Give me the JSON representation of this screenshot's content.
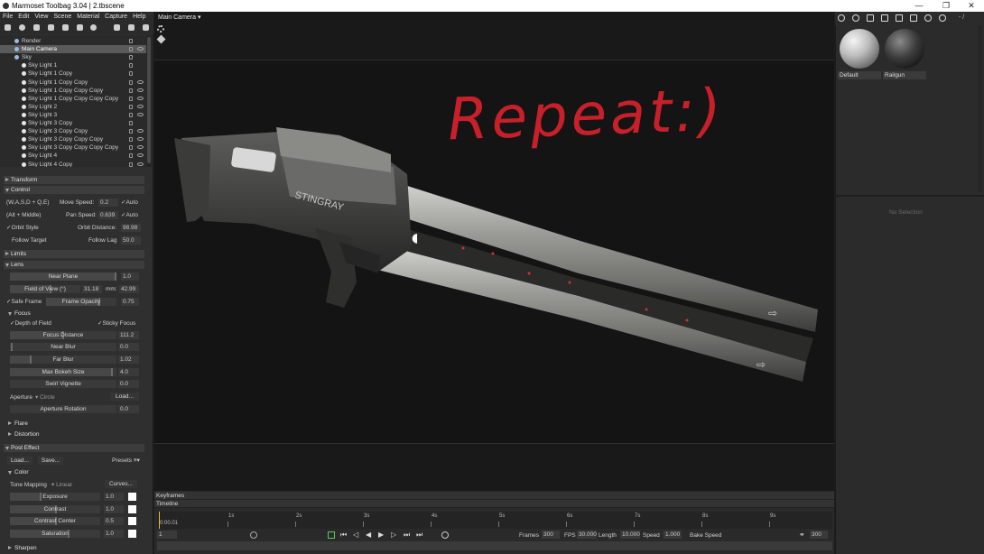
{
  "titlebar": {
    "title": "Marmoset Toolbag 3.04  |  2.tbscene",
    "minimize": "—",
    "maximize": "❐",
    "close": "✕"
  },
  "menu": [
    "File",
    "Edit",
    "View",
    "Scene",
    "Material",
    "Capture",
    "Help"
  ],
  "scene_tree": {
    "items": [
      {
        "label": "Render",
        "indent": 1,
        "selected": false,
        "eye": false
      },
      {
        "label": "Main Camera",
        "indent": 1,
        "selected": true,
        "eye": true
      },
      {
        "label": "Sky",
        "indent": 1,
        "selected": false,
        "eye": false
      },
      {
        "label": "Sky Light 1",
        "indent": 2,
        "selected": false,
        "eye": false
      },
      {
        "label": "Sky Light 1 Copy",
        "indent": 2,
        "selected": false,
        "eye": false
      },
      {
        "label": "Sky Light 1 Copy Copy",
        "indent": 2,
        "selected": false,
        "eye": true
      },
      {
        "label": "Sky Light 1 Copy Copy Copy",
        "indent": 2,
        "selected": false,
        "eye": true
      },
      {
        "label": "Sky Light 1 Copy Copy Copy Copy",
        "indent": 2,
        "selected": false,
        "eye": true
      },
      {
        "label": "Sky Light 2",
        "indent": 2,
        "selected": false,
        "eye": true
      },
      {
        "label": "Sky Light 3",
        "indent": 2,
        "selected": false,
        "eye": true
      },
      {
        "label": "Sky Light 3 Copy",
        "indent": 2,
        "selected": false,
        "eye": false
      },
      {
        "label": "Sky Light 3 Copy Copy",
        "indent": 2,
        "selected": false,
        "eye": true
      },
      {
        "label": "Sky Light 3 Copy Copy Copy",
        "indent": 2,
        "selected": false,
        "eye": true
      },
      {
        "label": "Sky Light 3 Copy Copy Copy Copy",
        "indent": 2,
        "selected": false,
        "eye": true
      },
      {
        "label": "Sky Light 4",
        "indent": 2,
        "selected": false,
        "eye": true
      },
      {
        "label": "Sky Light 4 Copy",
        "indent": 2,
        "selected": false,
        "eye": true
      }
    ]
  },
  "properties": {
    "transform": "Transform",
    "control": {
      "header": "Control",
      "keys_label": "(W,A,S,D + Q,E)",
      "move_speed_label": "Move Speed:",
      "move_speed": "0.2",
      "auto1": "Auto",
      "alt_label": "(Alt + Middle)",
      "pan_speed_label": "Pan Speed:",
      "pan_speed": "0.639",
      "auto2": "Auto",
      "orbit_style": "Orbit Style",
      "orbit_distance_label": "Orbit Distance:",
      "orbit_distance": "98.98",
      "follow_target": "Follow Target",
      "follow_lag_label": "Follow Lag",
      "follow_lag": "50.0"
    },
    "limits": "Limits",
    "lens": {
      "header": "Lens",
      "near_plane": "Near Plane",
      "near_plane_val": "1.0",
      "fov": "Field of View (°)",
      "fov_val": "31.18",
      "mm_label": "mm:",
      "mm_val": "42.99",
      "safe_frame": "Safe Frame",
      "frame_opacity": "Frame Opacity",
      "frame_opacity_val": "0.75"
    },
    "focus": {
      "header": "Focus",
      "depth_of_field": "Depth of Field",
      "sticky_focus": "Sticky Focus",
      "focus_distance": "Focus Distance",
      "focus_distance_val": "111.2",
      "near_blur": "Near Blur",
      "near_blur_val": "0.0",
      "far_blur": "Far Blur",
      "far_blur_val": "1.02",
      "max_bokeh": "Max Bokeh Size",
      "max_bokeh_val": "4.0",
      "swirl_vignette": "Swirl Vignette",
      "swirl_vignette_val": "0.0",
      "aperture_label": "Aperture",
      "aperture_val": "Circle",
      "load": "Load...",
      "aperture_rotation": "Aperture Rotation",
      "aperture_rotation_val": "0.0"
    },
    "flare": "Flare",
    "distortion": "Distortion",
    "post_effect": {
      "header": "Post Effect",
      "load": "Load...",
      "save": "Save...",
      "presets": "Presets",
      "color": "Color",
      "tone_mapping_label": "Tone Mapping",
      "tone_mapping_val": "Linear",
      "curves": "Curves...",
      "exposure": "Exposure",
      "exposure_val": "1.0",
      "contrast": "Contrast",
      "contrast_val": "1.0",
      "contrast_center": "Contrast Center",
      "contrast_center_val": "0.5",
      "saturation": "Saturation",
      "saturation_val": "1.0",
      "sharpen": "Sharpen"
    }
  },
  "viewport": {
    "camera_label": "Main Camera",
    "annotation": "Repeat:)",
    "annotation_color": "#c8202a",
    "model_text": "STINGRAY"
  },
  "timeline": {
    "keyframes": "Keyframes",
    "timeline": "Timeline",
    "current_time": "0:00.01",
    "ticks": [
      "1s",
      "2s",
      "3s",
      "4s",
      "5s",
      "6s",
      "7s",
      "8s",
      "9s"
    ],
    "frame_field": "1",
    "frames_label": "Frames",
    "frames_val": "300",
    "fps_label": "FPS",
    "fps_val": "30.000",
    "length_label": "Length",
    "length_val": "10.000",
    "speed_label": "Speed",
    "speed_val": "1.000",
    "bake_speed": "Bake Speed",
    "end_frame_val": "300"
  },
  "materials": {
    "path_label": "- /",
    "items": [
      {
        "name": "Default"
      },
      {
        "name": "Railgun"
      }
    ],
    "no_selection": "No Selection"
  }
}
